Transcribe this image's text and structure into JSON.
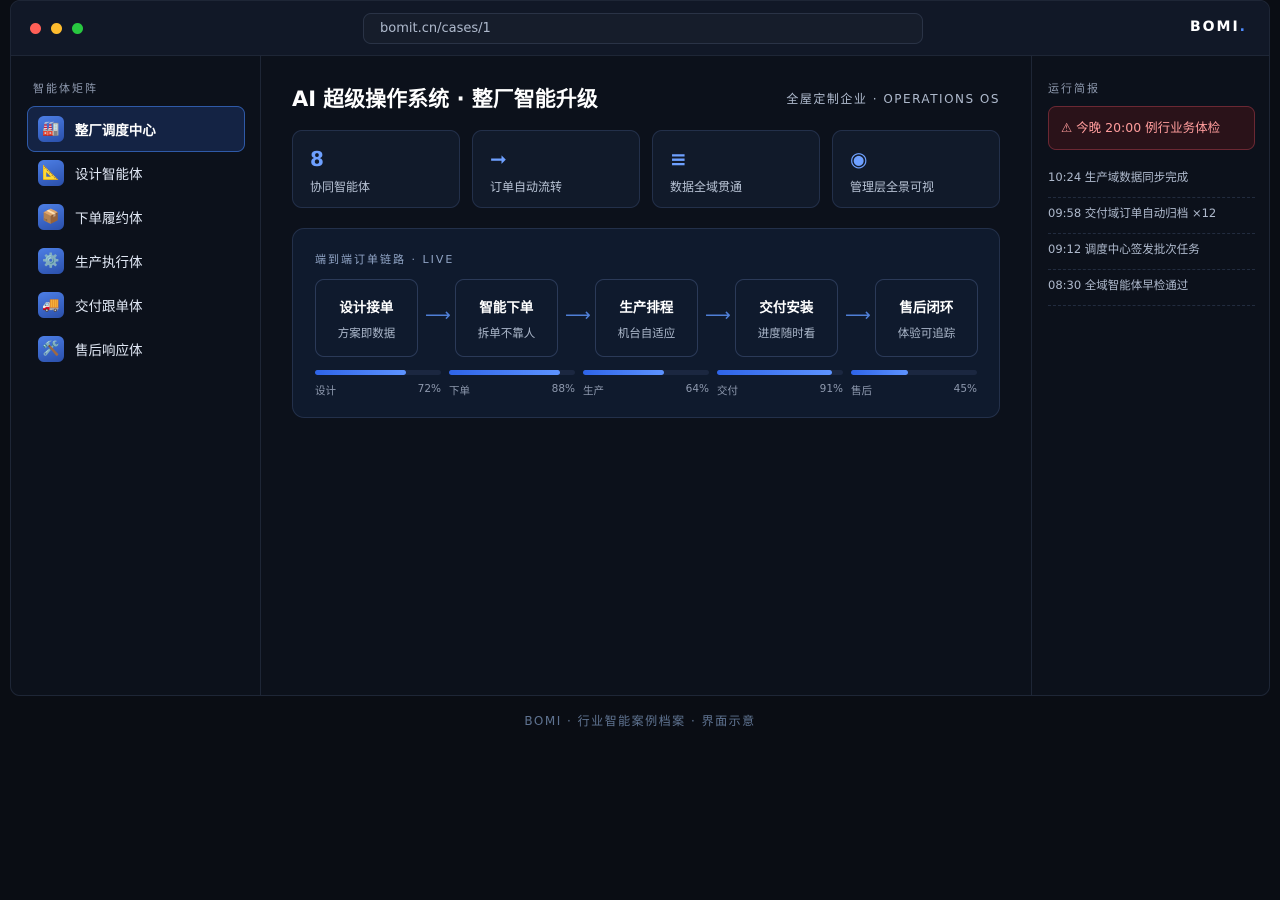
{
  "browser": {
    "url": "bomit.cn/cases/1",
    "brand": "BOMI",
    "brand_dot": "."
  },
  "sidebar": {
    "title": "智能体矩阵",
    "items": [
      {
        "label": "整厂调度中心",
        "icon": "factory-icon",
        "glyph": "🏭",
        "active": true
      },
      {
        "label": "设计智能体",
        "icon": "triangle-ruler-icon",
        "glyph": "📐",
        "active": false
      },
      {
        "label": "下单履约体",
        "icon": "package-icon",
        "glyph": "📦",
        "active": false
      },
      {
        "label": "生产执行体",
        "icon": "gear-icon",
        "glyph": "⚙️",
        "active": false
      },
      {
        "label": "交付跟单体",
        "icon": "truck-icon",
        "glyph": "🚚",
        "active": false
      },
      {
        "label": "售后响应体",
        "icon": "tools-icon",
        "glyph": "🛠️",
        "active": false
      }
    ]
  },
  "main": {
    "title": "AI 超级操作系统 · 整厂智能升级",
    "subtitle": "全屋定制企业 · OPERATIONS OS",
    "stats": [
      {
        "icon": "number-eight",
        "glyph": "8",
        "label": "协同智能体"
      },
      {
        "icon": "arrow-right-icon",
        "glyph": "➞",
        "label": "订单自动流转"
      },
      {
        "icon": "list-icon",
        "glyph": "≡",
        "label": "数据全域贯通"
      },
      {
        "icon": "eye-circle-icon",
        "glyph": "◉",
        "label": "管理层全景可视"
      }
    ],
    "flow": {
      "title": "端到端订单链路 · LIVE",
      "arrow": "⟶",
      "steps": [
        {
          "title": "设计接单",
          "sub": "方案即数据"
        },
        {
          "title": "智能下单",
          "sub": "拆单不靠人"
        },
        {
          "title": "生产排程",
          "sub": "机台自适应"
        },
        {
          "title": "交付安装",
          "sub": "进度随时看"
        },
        {
          "title": "售后闭环",
          "sub": "体验可追踪"
        }
      ],
      "progress": [
        {
          "label": "设计",
          "value": 72,
          "display": "72%"
        },
        {
          "label": "下单",
          "value": 88,
          "display": "88%"
        },
        {
          "label": "生产",
          "value": 64,
          "display": "64%"
        },
        {
          "label": "交付",
          "value": 91,
          "display": "91%"
        },
        {
          "label": "售后",
          "value": 45,
          "display": "45%"
        }
      ]
    }
  },
  "right": {
    "title": "运行简报",
    "alert": "⚠ 今晚 20:00 例行业务体检",
    "logs": [
      "10:24 生产域数据同步完成",
      "09:58 交付域订单自动归档 ×12",
      "09:12 调度中心签发批次任务",
      "08:30 全域智能体早检通过"
    ]
  },
  "footer": "BOMI · 行业智能案例档案 · 界面示意",
  "colors": {
    "accent": "#4f8cff",
    "alert_text": "#ff9c9c",
    "alert_bg": "#2a1219"
  }
}
